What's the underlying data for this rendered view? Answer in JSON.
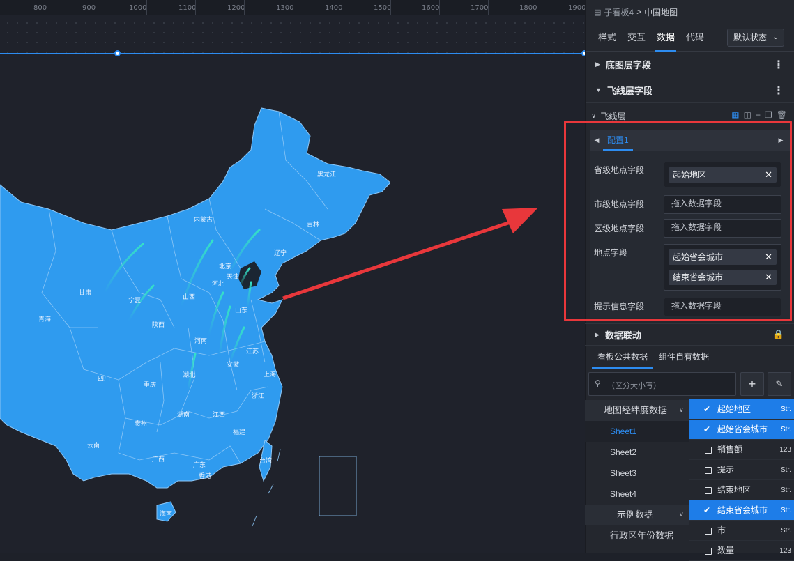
{
  "ruler": {
    "ticks": [
      "800",
      "900",
      "1000",
      "1100",
      "1200",
      "1300",
      "1400",
      "1500",
      "1600",
      "1700",
      "1800",
      "1900"
    ]
  },
  "map": {
    "provinces": [
      "黑龙江",
      "内蒙古",
      "吉林",
      "辽宁",
      "北京",
      "天津",
      "河北",
      "甘肃",
      "宁夏",
      "山西",
      "山东",
      "青海",
      "陕西",
      "河南",
      "江苏",
      "安徽",
      "上海",
      "四川",
      "重庆",
      "湖北",
      "浙江",
      "湖南",
      "江西",
      "贵州",
      "云南",
      "福建",
      "广西",
      "广东",
      "台湾",
      "香港",
      "海南"
    ],
    "colors": {
      "land": "#2f9bef",
      "border": "#8cc6f6",
      "flyline": "#35e0c8",
      "highlight": "#1b2633"
    }
  },
  "panel": {
    "breadcrumb": {
      "parent": "子看板4",
      "sep": ">",
      "current": "中国地图"
    },
    "tabs": [
      "样式",
      "交互",
      "数据",
      "代码"
    ],
    "active_tab": "数据",
    "state_select": "默认状态",
    "sections": {
      "base_fields": "底图层字段",
      "flyline_fields": "飞线层字段",
      "linkage": "数据联动"
    },
    "layer_name": "飞线层",
    "config_tab": "配置1",
    "fields": {
      "province_label": "省级地点字段",
      "province_chip": "起始地区",
      "city_label": "市级地点字段",
      "city_placeholder": "拖入数据字段",
      "district_label": "区级地点字段",
      "district_placeholder": "拖入数据字段",
      "location_label": "地点字段",
      "location_chip1": "起始省会城市",
      "location_chip2": "结束省会城市",
      "tooltip_label": "提示信息字段",
      "tooltip_placeholder": "拖入数据字段"
    },
    "data_tabs": [
      "看板公共数据",
      "组件自有数据"
    ],
    "search_placeholder": "（区分大小写）",
    "tree": {
      "group1": "地图经纬度数据",
      "sheets": [
        "Sheet1",
        "Sheet2",
        "Sheet3",
        "Sheet4"
      ],
      "group2": "示例数据",
      "group3": "行政区年份数据"
    },
    "field_list": [
      {
        "name": "起始地区",
        "type": "Str.",
        "selected": true
      },
      {
        "name": "起始省会城市",
        "type": "Str.",
        "selected": true
      },
      {
        "name": "销售额",
        "type": "123",
        "selected": false
      },
      {
        "name": "提示",
        "type": "Str.",
        "selected": false
      },
      {
        "name": "结束地区",
        "type": "Str.",
        "selected": false
      },
      {
        "name": "结束省会城市",
        "type": "Str.",
        "selected": true
      },
      {
        "name": "市",
        "type": "Str.",
        "selected": false
      },
      {
        "name": "数量",
        "type": "123",
        "selected": false
      }
    ]
  }
}
